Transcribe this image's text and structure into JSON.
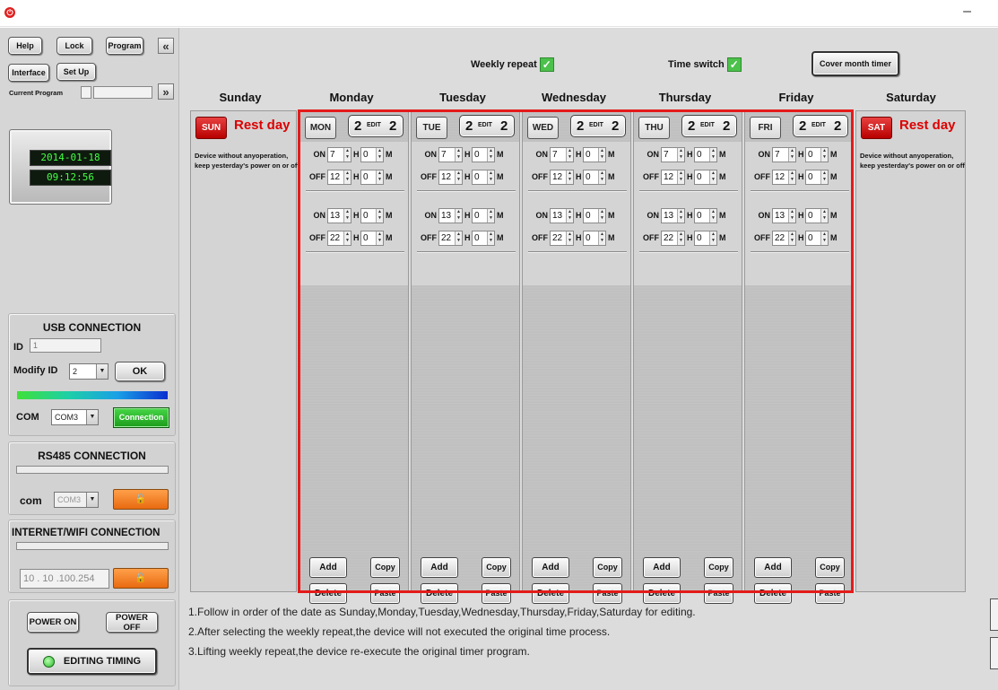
{
  "left": {
    "help": "Help",
    "lock": "Lock",
    "program": "Program",
    "collapse": "«",
    "interface": "Interface",
    "setup": "Set Up",
    "current_program_label": "Current Program",
    "expand": "»",
    "date": "2014-01-18",
    "time": "09:12:56",
    "usb": {
      "title": "USB CONNECTION",
      "id_label": "ID",
      "id_value": "1",
      "modify_label": "Modify ID",
      "modify_value": "2",
      "ok": "OK",
      "com_label": "COM",
      "com_value": "COM3",
      "connect": "Connection"
    },
    "rs485": {
      "title": "RS485 CONNECTION",
      "com_label": "com",
      "com_value": "COM3"
    },
    "wifi": {
      "title": "INTERNET/WIFI CONNECTION",
      "ip": "10 . 10 .100.254"
    },
    "power_on": "POWER ON",
    "power_off": "POWER OFF",
    "editing": "EDITING TIMING"
  },
  "top": {
    "weekly_repeat": "Weekly repeat",
    "time_switch": "Time switch",
    "cover": "Cover month timer"
  },
  "days": [
    {
      "header": "Sunday",
      "tag": "SUN",
      "rest": "Rest day",
      "note": "Device without anyoperation, keep yesterday's power on or off"
    },
    {
      "header": "Monday",
      "tag": "MON",
      "count": "2",
      "edit": "EDIT"
    },
    {
      "header": "Tuesday",
      "tag": "TUE",
      "count": "2",
      "edit": "EDIT"
    },
    {
      "header": "Wednesday",
      "tag": "WED",
      "count": "2",
      "edit": "EDIT"
    },
    {
      "header": "Thursday",
      "tag": "THU",
      "count": "2",
      "edit": "EDIT"
    },
    {
      "header": "Friday",
      "tag": "FRI",
      "count": "2",
      "edit": "EDIT"
    },
    {
      "header": "Saturday",
      "tag": "SAT",
      "rest": "Rest day",
      "note": "Device without anyoperation, keep yesterday's power on or off"
    }
  ],
  "timer": {
    "on_label": "ON",
    "off_label": "OFF",
    "h": "H",
    "m": "M",
    "on1_h": "7",
    "on1_m": "0",
    "off1_h": "12",
    "off1_m": "0",
    "on2_h": "13",
    "on2_m": "0",
    "off2_h": "22",
    "off2_m": "0"
  },
  "actions": {
    "add": "Add",
    "copy": "Copy",
    "delete": "Delete",
    "paste": "Paste"
  },
  "notes": [
    "1.Follow in order of the date as Sunday,Monday,Tuesday,Wednesday,Thursday,Friday,Saturday for editing.",
    "2.After selecting the weekly repeat,the device will not executed the original time process.",
    "3.Lifting weekly repeat,the device re-execute the original timer program."
  ]
}
